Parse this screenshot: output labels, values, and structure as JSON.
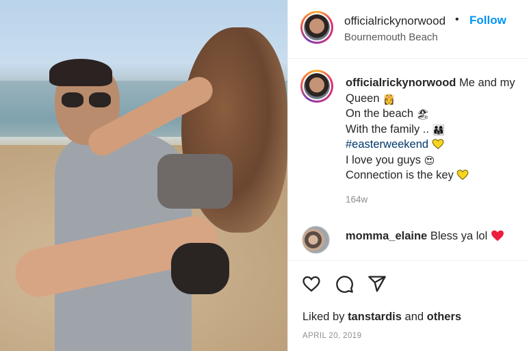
{
  "post": {
    "username": "officialrickynorwood",
    "dot": "•",
    "follow_label": "Follow",
    "location": "Bournemouth Beach"
  },
  "caption": {
    "username": "officialrickynorwood",
    "lines": [
      "Me and my Queen",
      "On the beach",
      "With the family ..",
      "#easterweekend",
      "I love you guys",
      "Connection is the key"
    ],
    "emojis": {
      "queen": "👸",
      "beach": "🏖",
      "family": "👨‍👩‍👧",
      "love_eyes": "😍"
    },
    "time_ago": "164w"
  },
  "comment": {
    "username": "momma_elaine",
    "text": "Bless ya lol"
  },
  "actions": {
    "icons": [
      "heart-icon",
      "comment-icon",
      "share-icon"
    ]
  },
  "likes": {
    "prefix": "Liked by",
    "user": "tanstardis",
    "and": "and",
    "others": "others"
  },
  "date": "APRIL 20, 2019",
  "colors": {
    "follow": "#0095f6",
    "hashtag": "#00376b",
    "muted": "#8e8e8e",
    "heart_red": "#ed1d3e",
    "heart_yellow": "#f7d51d"
  }
}
